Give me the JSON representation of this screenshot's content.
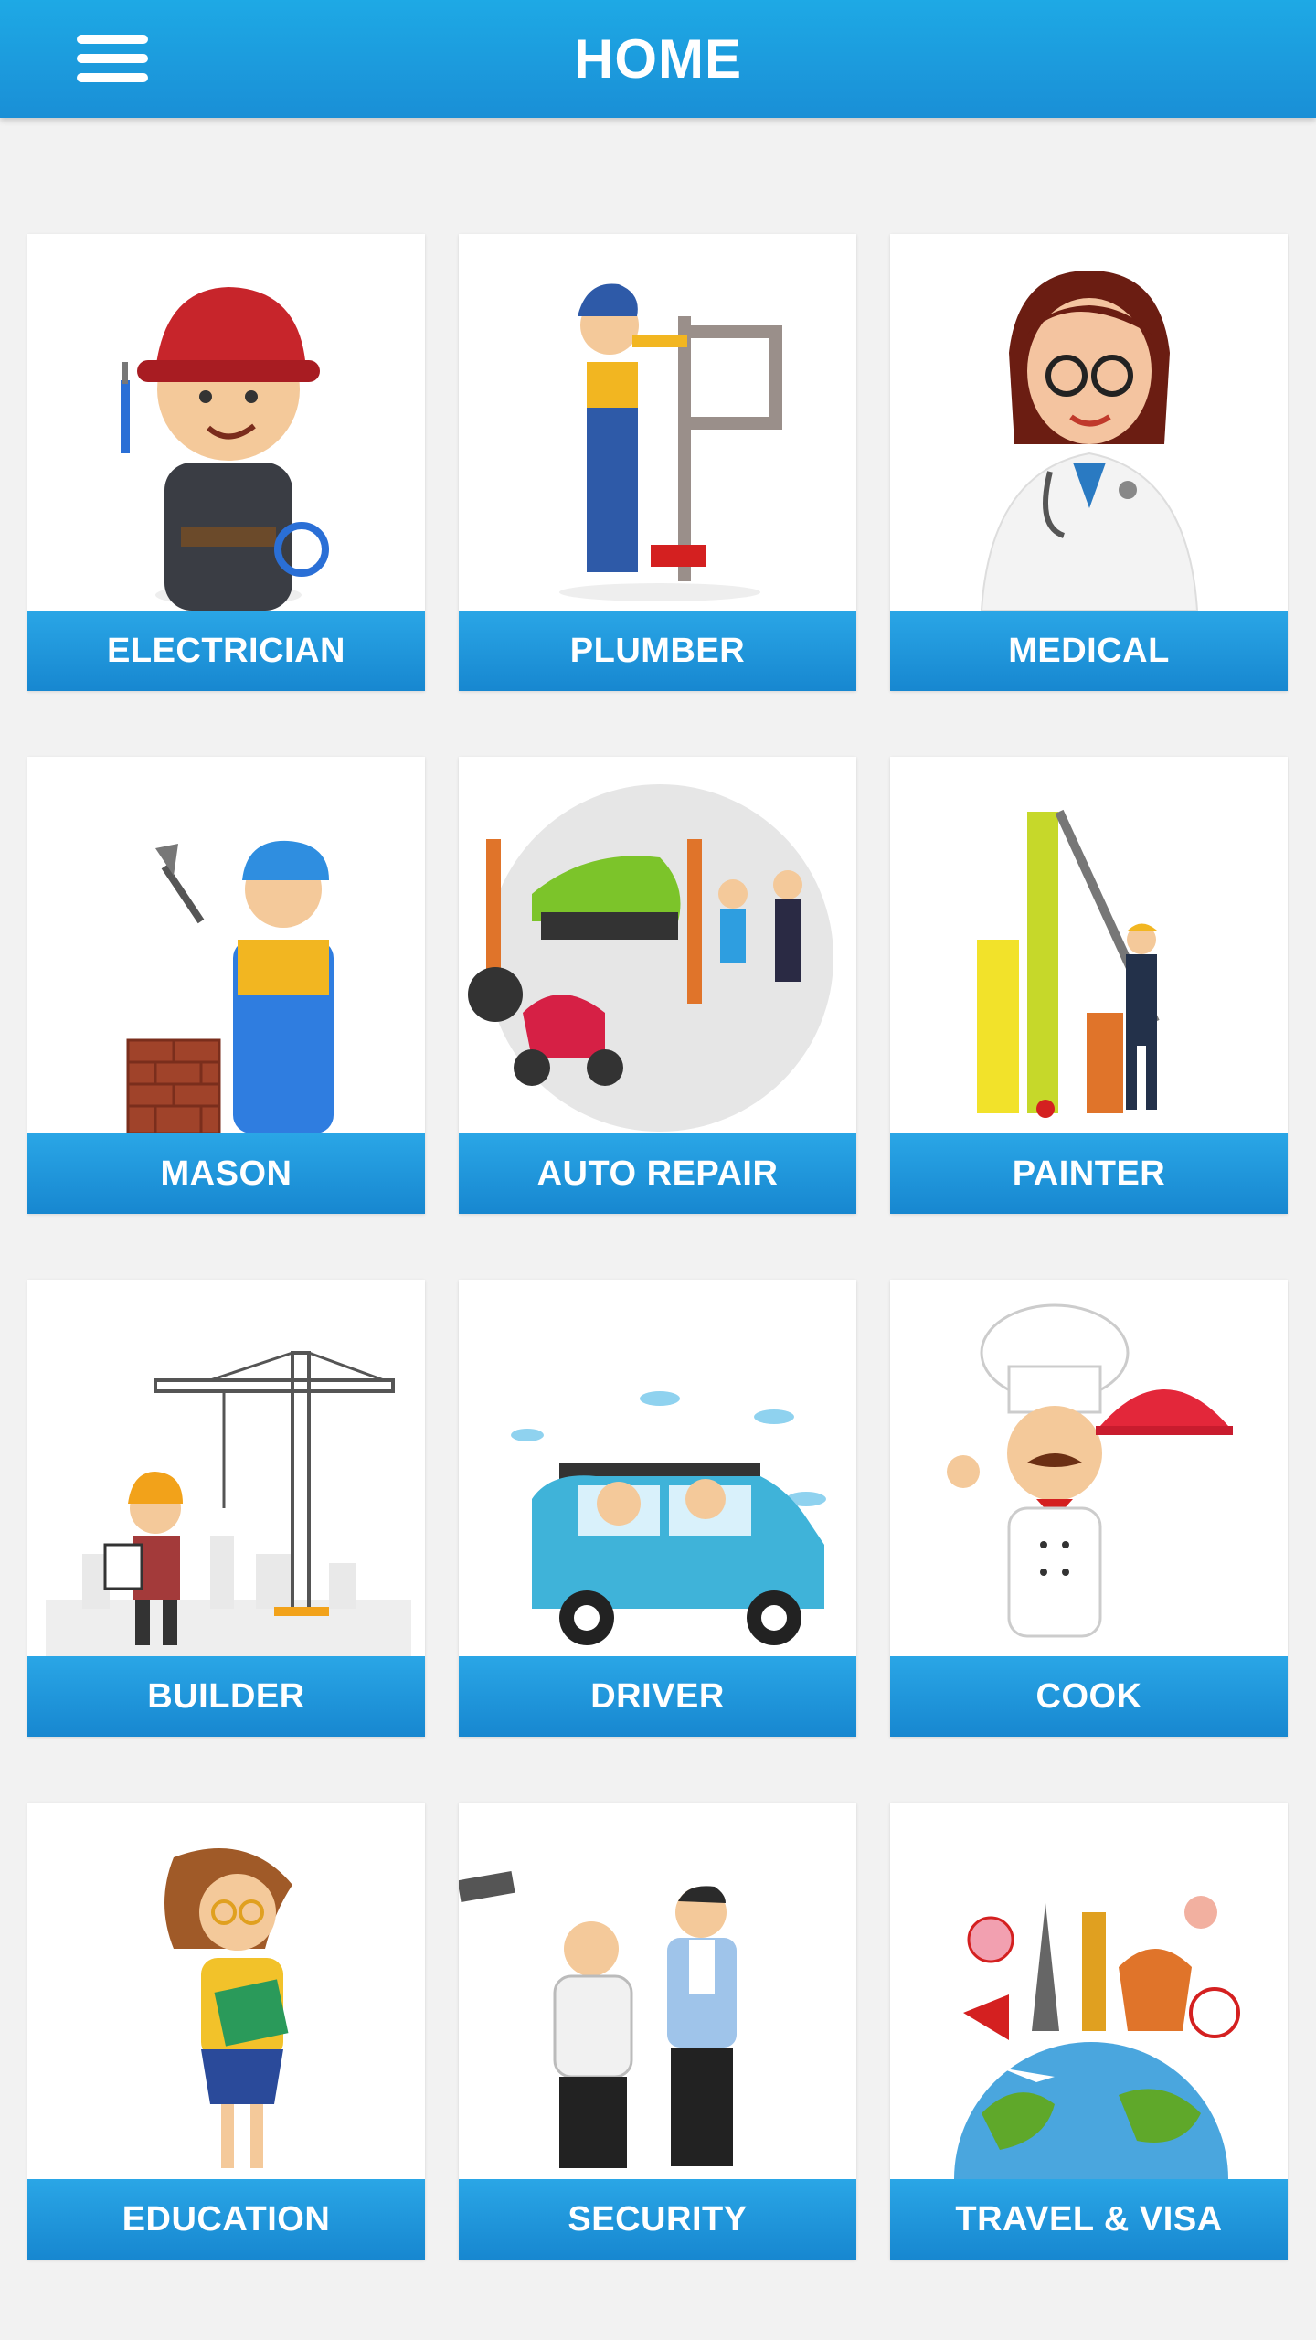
{
  "header": {
    "title": "HOME",
    "menu_icon": "hamburger-menu-icon"
  },
  "colors": {
    "accent": "#1a8fd6",
    "accent_light": "#2aa6e6",
    "background": "#f2f2f2"
  },
  "categories": [
    {
      "label": "ELECTRICIAN",
      "icon": "electrician-illustration"
    },
    {
      "label": "PLUMBER",
      "icon": "plumber-illustration"
    },
    {
      "label": "MEDICAL",
      "icon": "doctor-illustration"
    },
    {
      "label": "MASON",
      "icon": "mason-illustration"
    },
    {
      "label": "AUTO REPAIR",
      "icon": "auto-repair-illustration"
    },
    {
      "label": "PAINTER",
      "icon": "painter-illustration"
    },
    {
      "label": "BUILDER",
      "icon": "builder-crane-illustration"
    },
    {
      "label": "DRIVER",
      "icon": "car-driver-illustration"
    },
    {
      "label": "COOK",
      "icon": "chef-illustration"
    },
    {
      "label": "EDUCATION",
      "icon": "teacher-illustration"
    },
    {
      "label": "SECURITY",
      "icon": "security-guards-illustration"
    },
    {
      "label": "TRAVEL & VISA",
      "icon": "travel-globe-illustration"
    }
  ]
}
